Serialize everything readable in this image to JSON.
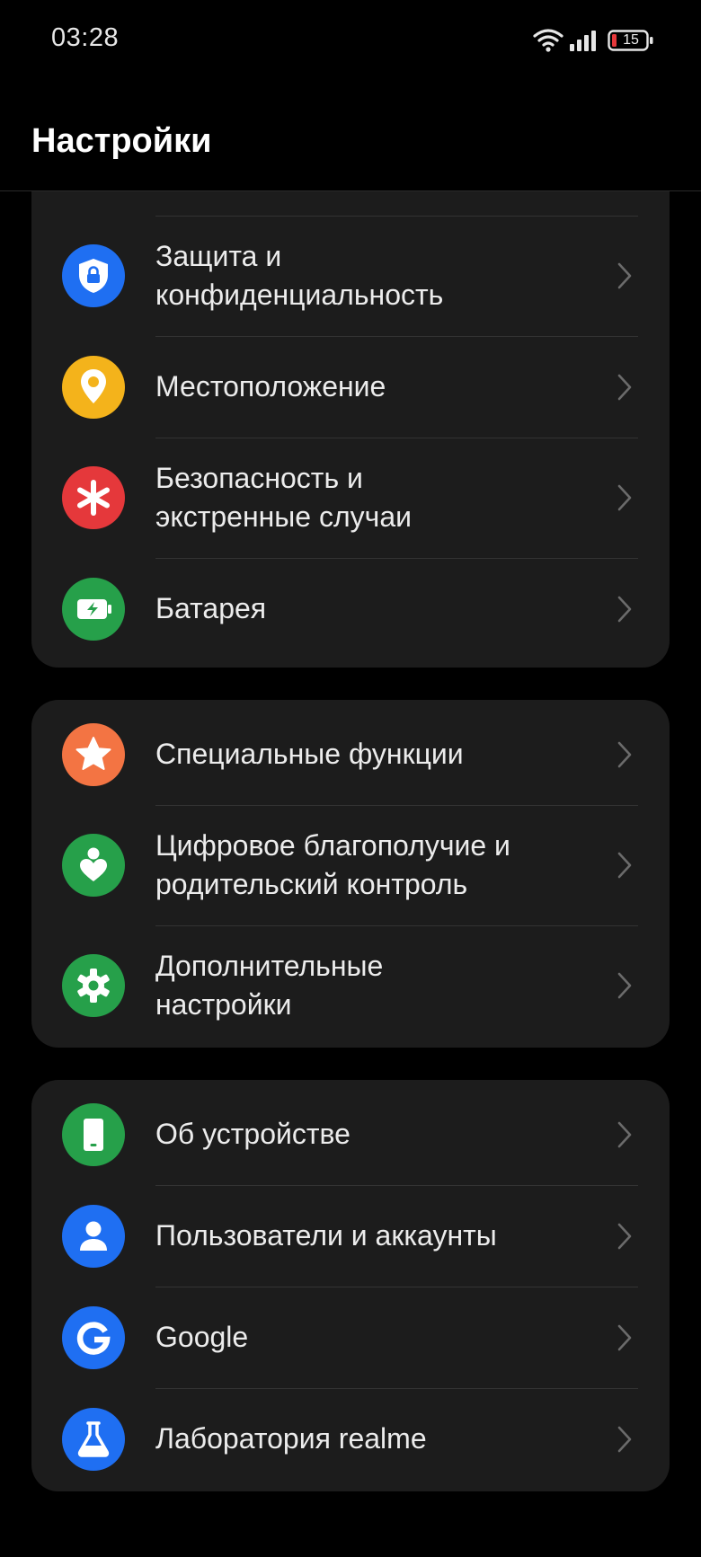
{
  "status_bar": {
    "time": "03:28",
    "battery_level": "15",
    "icons": [
      "wifi-icon",
      "signal-icon",
      "battery-icon"
    ]
  },
  "header": {
    "title": "Настройки"
  },
  "colors": {
    "blue": "#1f6ff2",
    "yellow": "#f4b31b",
    "red": "#e5383b",
    "green": "#26a04a",
    "orange": "#f37443",
    "card": "#1c1c1c"
  },
  "groups": [
    {
      "items": [
        {
          "label": "",
          "icon": "partial-green-icon",
          "color": "#26a04a"
        },
        {
          "label": "Защита и\nконфиденциальность",
          "icon": "shield-lock-icon",
          "color": "#1f6ff2"
        },
        {
          "label": "Местоположение",
          "icon": "location-pin-icon",
          "color": "#f4b31b"
        },
        {
          "label": "Безопасность и\nэкстренные случаи",
          "icon": "asterisk-icon",
          "color": "#e5383b"
        },
        {
          "label": "Батарея",
          "icon": "battery-charging-icon",
          "color": "#26a04a"
        }
      ]
    },
    {
      "items": [
        {
          "label": "Специальные функции",
          "icon": "star-icon",
          "color": "#f37443"
        },
        {
          "label": "Цифровое благополучие и\nродительский контроль",
          "icon": "person-heart-icon",
          "color": "#26a04a"
        },
        {
          "label": "Дополнительные\nнастройки",
          "icon": "gear-icon",
          "color": "#26a04a"
        }
      ]
    },
    {
      "items": [
        {
          "label": "Об устройстве",
          "icon": "phone-icon",
          "color": "#26a04a"
        },
        {
          "label": "Пользователи и аккаунты",
          "icon": "user-icon",
          "color": "#1f6ff2"
        },
        {
          "label": "Google",
          "icon": "google-icon",
          "color": "#1f6ff2"
        },
        {
          "label": "Лаборатория realme",
          "icon": "flask-icon",
          "color": "#1f6ff2"
        }
      ]
    }
  ]
}
